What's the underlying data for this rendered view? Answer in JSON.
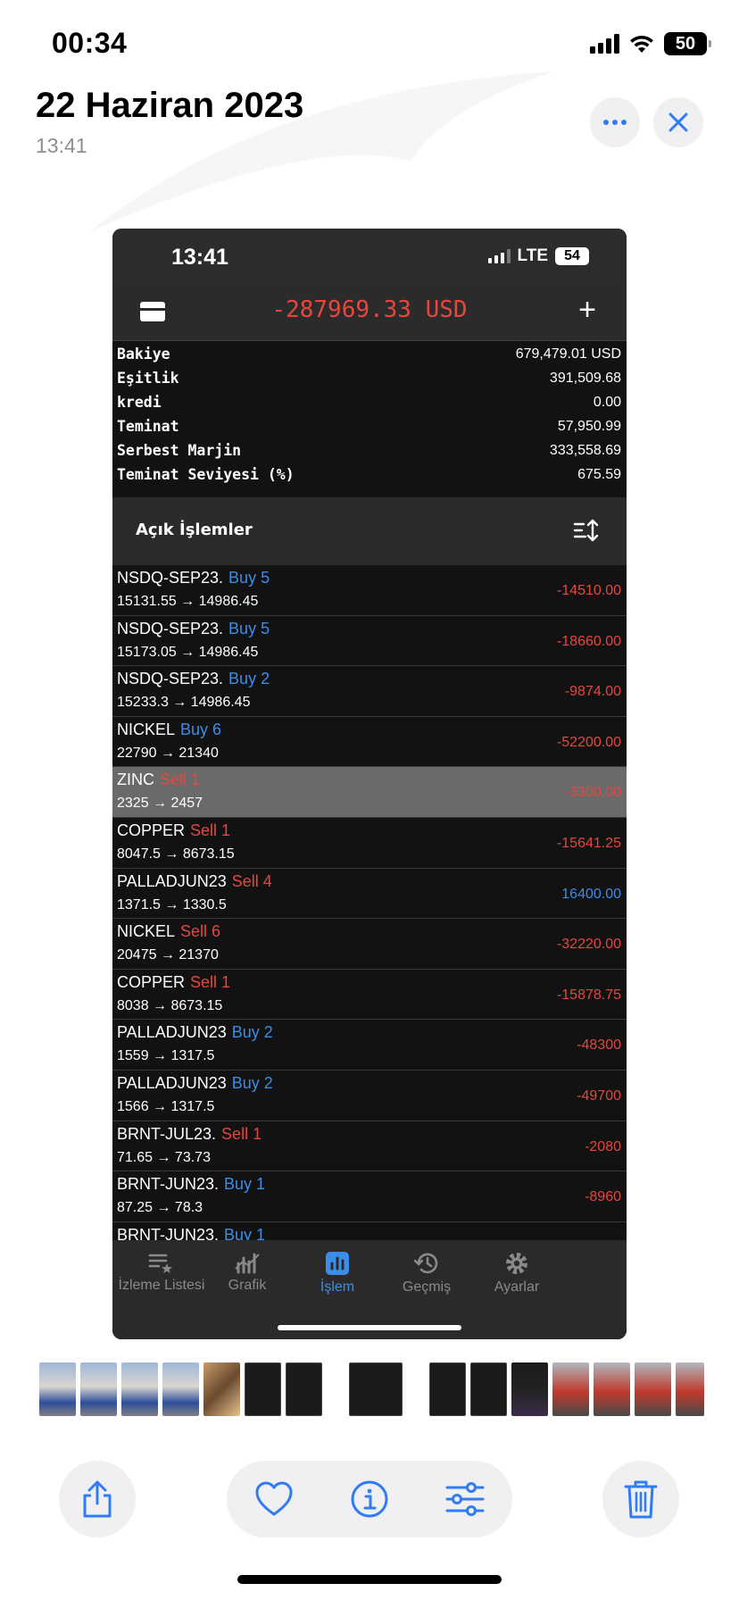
{
  "status_bar": {
    "time": "00:34",
    "battery": "50"
  },
  "photo": {
    "title": "22 Haziran 2023",
    "subtitle": "13:41"
  },
  "colors": {
    "accent": "#2f7cf6",
    "loss": "#e5473f",
    "buy": "#3b8de8",
    "dark_bg": "#121212"
  },
  "screenshot": {
    "status": {
      "time": "13:41",
      "network": "LTE",
      "battery": "54"
    },
    "header": {
      "total": "-287969.33 USD",
      "left_icon": "card-icon",
      "right_label": "+"
    },
    "account": [
      {
        "label": "Bakiye",
        "value": "679,479.01 USD"
      },
      {
        "label": "Eşitlik",
        "value": "391,509.68"
      },
      {
        "label": "kredi",
        "value": "0.00"
      },
      {
        "label": "Teminat",
        "value": "57,950.99"
      },
      {
        "label": "Serbest Marjin",
        "value": "333,558.69"
      },
      {
        "label": "Teminat Seviyesi (%)",
        "value": "675.59"
      }
    ],
    "open_positions_title": "Açık İşlemler",
    "trades": [
      {
        "symbol": "NSDQ-SEP23.",
        "side": "Buy 5",
        "type": "buy",
        "prices": "15131.55 → 14986.45",
        "pl": "-14510.00",
        "pl_sign": "neg"
      },
      {
        "symbol": "NSDQ-SEP23.",
        "side": "Buy 5",
        "type": "buy",
        "prices": "15173.05 → 14986.45",
        "pl": "-18660.00",
        "pl_sign": "neg"
      },
      {
        "symbol": "NSDQ-SEP23.",
        "side": "Buy 2",
        "type": "buy",
        "prices": "15233.3 → 14986.45",
        "pl": "-9874.00",
        "pl_sign": "neg"
      },
      {
        "symbol": "NICKEL",
        "side": "Buy 6",
        "type": "buy",
        "prices": "22790 → 21340",
        "pl": "-52200.00",
        "pl_sign": "neg"
      },
      {
        "symbol": "ZINC",
        "side": "Sell 1",
        "type": "sell",
        "prices": "2325 → 2457",
        "pl": "-3300.00",
        "pl_sign": "neg",
        "selected": true
      },
      {
        "symbol": "COPPER",
        "side": "Sell 1",
        "type": "sell",
        "prices": "8047.5 → 8673.15",
        "pl": "-15641.25",
        "pl_sign": "neg"
      },
      {
        "symbol": "PALLADJUN23",
        "side": "Sell 4",
        "type": "sell",
        "prices": "1371.5 → 1330.5",
        "pl": "16400.00",
        "pl_sign": "pos"
      },
      {
        "symbol": "NICKEL",
        "side": "Sell 6",
        "type": "sell",
        "prices": "20475 → 21370",
        "pl": "-32220.00",
        "pl_sign": "neg"
      },
      {
        "symbol": "COPPER",
        "side": "Sell 1",
        "type": "sell",
        "prices": "8038 → 8673.15",
        "pl": "-15878.75",
        "pl_sign": "neg"
      },
      {
        "symbol": "PALLADJUN23",
        "side": "Buy 2",
        "type": "buy",
        "prices": "1559 → 1317.5",
        "pl": "-48300",
        "pl_sign": "neg"
      },
      {
        "symbol": "PALLADJUN23",
        "side": "Buy 2",
        "type": "buy",
        "prices": "1566 → 1317.5",
        "pl": "-49700",
        "pl_sign": "neg"
      },
      {
        "symbol": "BRNT-JUL23.",
        "side": "Sell 1",
        "type": "sell",
        "prices": "71.65 → 73.73",
        "pl": "-2080",
        "pl_sign": "neg"
      },
      {
        "symbol": "BRNT-JUN23.",
        "side": "Buy 1",
        "type": "buy",
        "prices": "87.25 → 78.3",
        "pl": "-8960",
        "pl_sign": "neg"
      },
      {
        "symbol": "BRNT-JUN23.",
        "side": "Buy 1",
        "type": "buy",
        "prices": "",
        "pl": "",
        "pl_sign": "neg"
      }
    ],
    "tabs": [
      {
        "label": "İzleme Listesi",
        "icon": "watchlist-icon"
      },
      {
        "label": "Grafik",
        "icon": "chart-icon"
      },
      {
        "label": "İşlem",
        "icon": "trade-icon",
        "active": true
      },
      {
        "label": "Geçmiş",
        "icon": "history-icon"
      },
      {
        "label": "Ayarlar",
        "icon": "settings-icon"
      }
    ]
  },
  "toolbar": {
    "share_icon": "share-icon",
    "favorite_icon": "heart-icon",
    "info_icon": "info-icon",
    "adjust_icon": "adjust-icon",
    "delete_icon": "trash-icon"
  }
}
